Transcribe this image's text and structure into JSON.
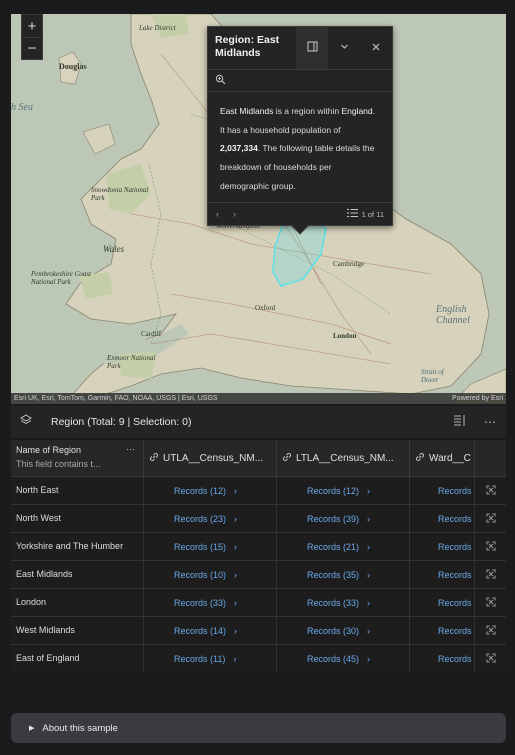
{
  "map": {
    "zoom_in": "+",
    "zoom_out": "−",
    "attribution": "Esri UK, Esri, TomTom, Garmin, FAO, NOAA, USGS | Esri, USGS",
    "powered_by": "Powered by Esri",
    "labels": {
      "douglas": "Douglas",
      "irish_sea": "h Sea",
      "snowdonia": "Snowdonia National Park",
      "wales": "Wales",
      "pembrokeshire": "Pembrokeshire Coast National Park",
      "cambridge": "Cambridge",
      "english_channel": "English Channel",
      "strait": "Strait of Dover",
      "exmoor": "Exmoor National Park",
      "lake_district": "Lake District",
      "wolverhampton": "Wolverhampton",
      "oxford": "Oxford",
      "cardiff": "Cardiff",
      "london": "London"
    }
  },
  "popup": {
    "title": "Region: East Midlands",
    "dock_icon": "dock-icon",
    "collapse_icon": "chevron-down-icon",
    "close_icon": "close-icon",
    "zoom_tool_icon": "zoom-to-icon",
    "body": {
      "region": "East Midlands",
      "t1": " is a region within ",
      "country": "England",
      "t2": ". It has a household population of ",
      "population": "2,037,334",
      "t3": ". The following table details the breakdown of households per demographic group."
    },
    "prev": "‹",
    "next": "›",
    "page_count": "1 of 11"
  },
  "table": {
    "title": "Region (Total: 9 | Selection: 0)",
    "columns": {
      "name": "Name of Region",
      "name_desc": "This field contains t...",
      "utla": "UTLA__Census_NM...",
      "ltla": "LTLA__Census_NM...",
      "ward": "Ward__C"
    },
    "rows": [
      {
        "name": "North East",
        "utla": "Records (12)",
        "ltla": "Records (12)",
        "ward": "Records"
      },
      {
        "name": "North West",
        "utla": "Records (23)",
        "ltla": "Records (39)",
        "ward": "Records"
      },
      {
        "name": "Yorkshire and The Humber",
        "utla": "Records (15)",
        "ltla": "Records (21)",
        "ward": "Records"
      },
      {
        "name": "East Midlands",
        "utla": "Records (10)",
        "ltla": "Records (35)",
        "ward": "Records"
      },
      {
        "name": "London",
        "utla": "Records (33)",
        "ltla": "Records (33)",
        "ward": "Records"
      },
      {
        "name": "West Midlands",
        "utla": "Records (14)",
        "ltla": "Records (30)",
        "ward": "Records"
      },
      {
        "name": "East of England",
        "utla": "Records (11)",
        "ltla": "Records (45)",
        "ward": "Records"
      }
    ]
  },
  "about": {
    "label": "About this sample"
  },
  "colors": {
    "link": "#6aa9e9",
    "highlight": "#5fe0e8",
    "panel": "#242424"
  }
}
